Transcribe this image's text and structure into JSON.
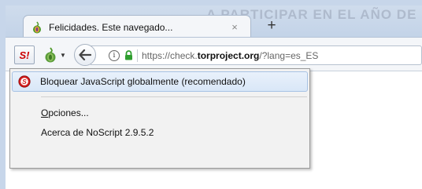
{
  "window": {
    "ghost_title": "A PARTICIPAR EN EL AÑO DE"
  },
  "tab": {
    "title": "Felicidades. Este navegado...",
    "close_glyph": "×",
    "icon": "onion-icon"
  },
  "new_tab": {
    "glyph": "+"
  },
  "toolbar": {
    "noscript_label": "S!",
    "noscript_icon": "noscript-icon",
    "tor_icon": "onion-icon",
    "back_icon": "back-arrow-icon"
  },
  "urlbar": {
    "info_glyph": "i",
    "url_prefix": "https://check.",
    "url_host": "torproject.org",
    "url_suffix": "/?lang=es_ES"
  },
  "menu": {
    "items": [
      {
        "label": "Bloquear JavaScript globalmente (recomendado)",
        "icon": "noscript-icon",
        "highlighted": true
      },
      {
        "label_mnemonic": "O",
        "label_rest": "pciones..."
      },
      {
        "label": "Acerca de NoScript 2.9.5.2"
      }
    ]
  },
  "colors": {
    "frame": "#c7d6ea",
    "noscript_red": "#cc0000",
    "onion_green": "#4f9a2a",
    "lock_green": "#2f9e2f",
    "menu_highlight": "#d9e7f7"
  }
}
